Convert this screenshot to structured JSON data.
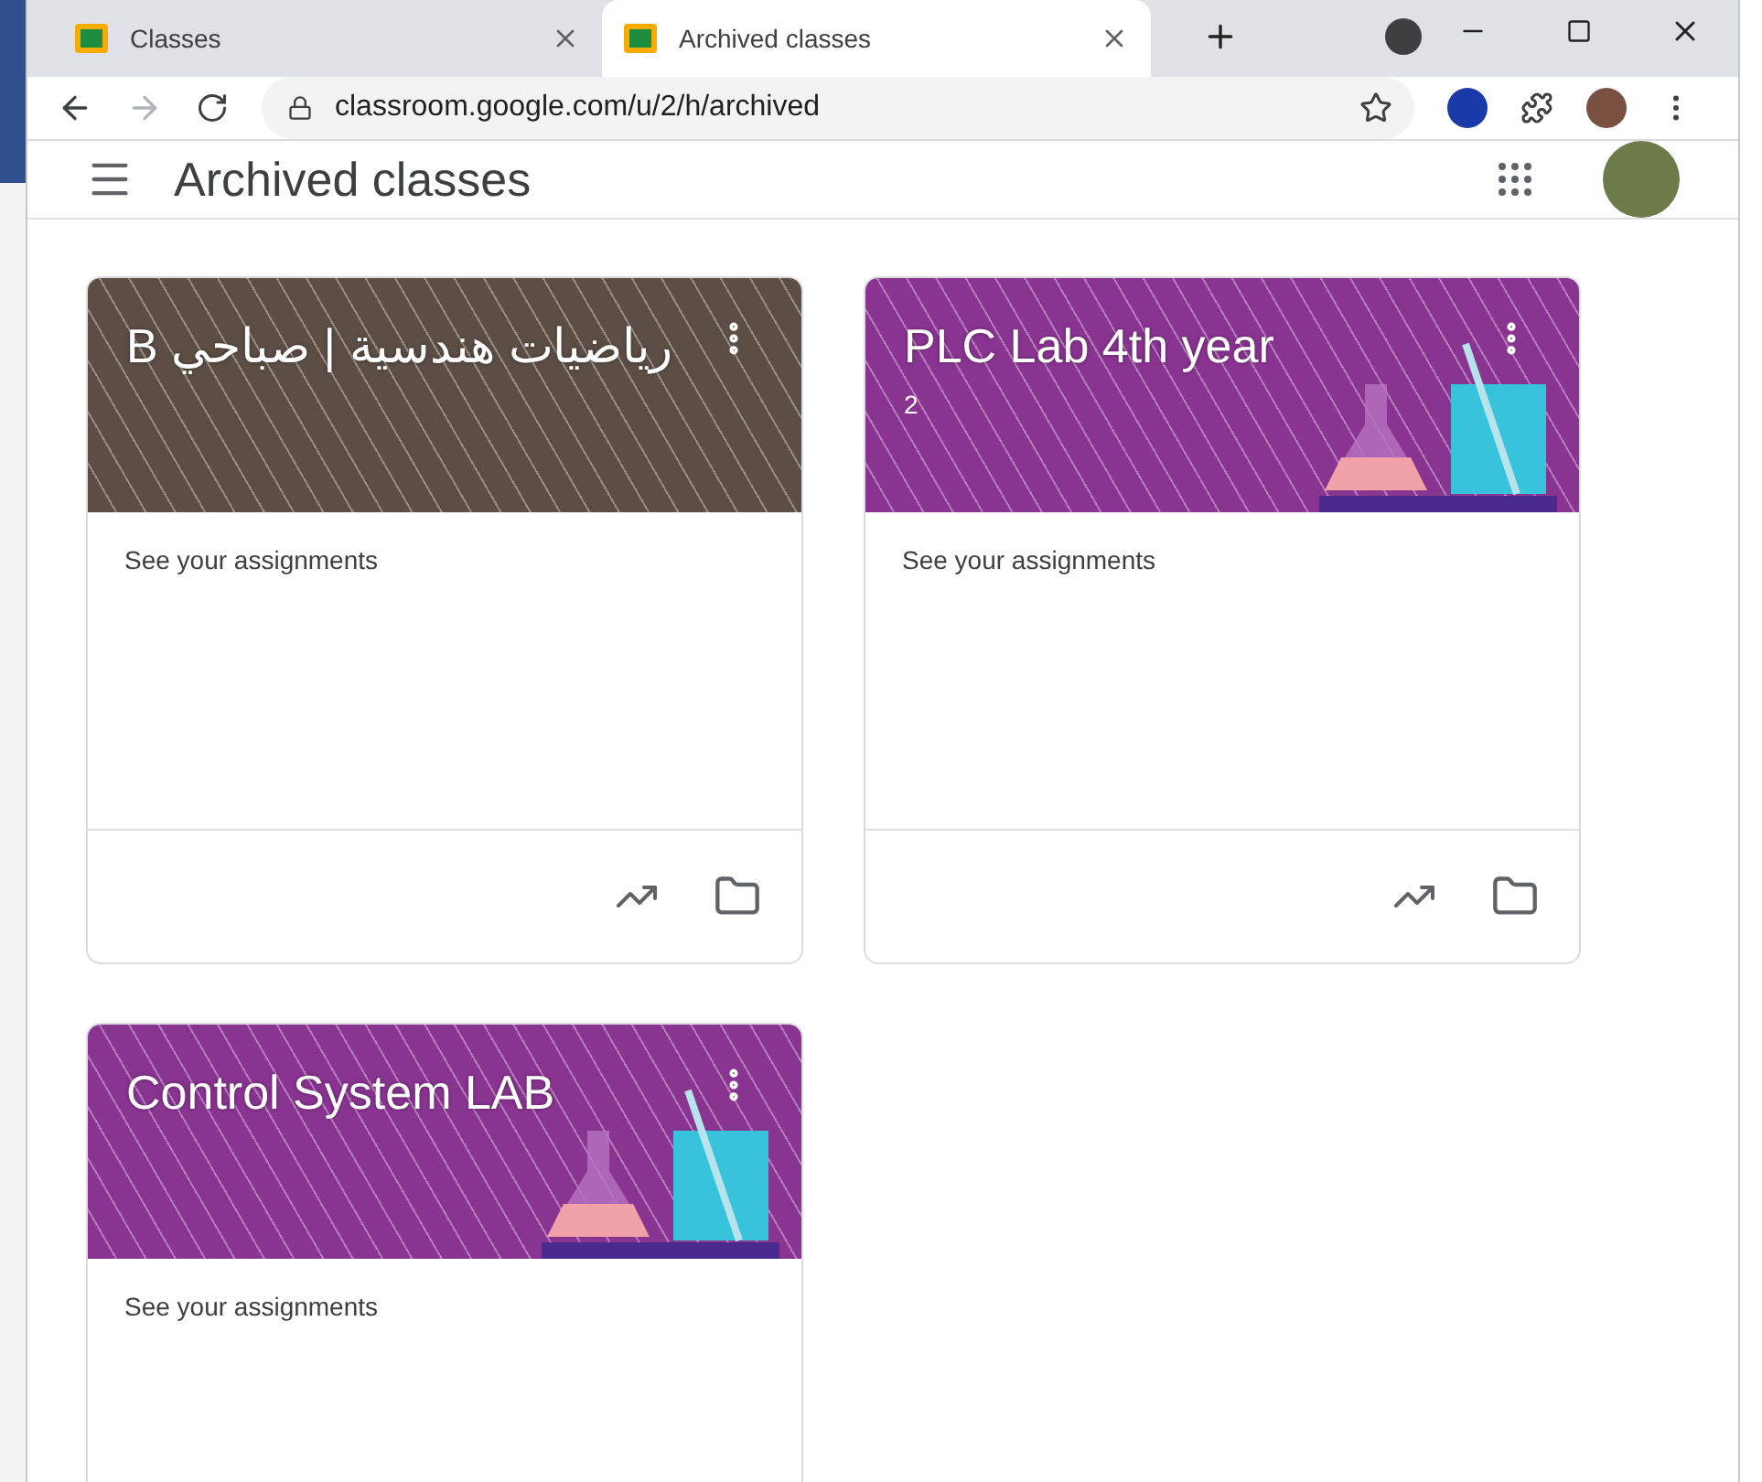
{
  "browser": {
    "tabs": [
      {
        "title": "Classes",
        "selected": false
      },
      {
        "title": "Archived classes",
        "selected": true
      }
    ],
    "url": "classroom.google.com/u/2/h/archived"
  },
  "header": {
    "title": "Archived classes"
  },
  "classes": [
    {
      "title": "رياضيات هندسية | صباحي B",
      "kind": "photo",
      "link": "See your assignments"
    },
    {
      "title": "PLC Lab 4th year",
      "subtitle": "2",
      "kind": "lab",
      "link": "See your assignments"
    },
    {
      "title": "Control System LAB",
      "kind": "lab",
      "link": "See your assignments"
    }
  ]
}
